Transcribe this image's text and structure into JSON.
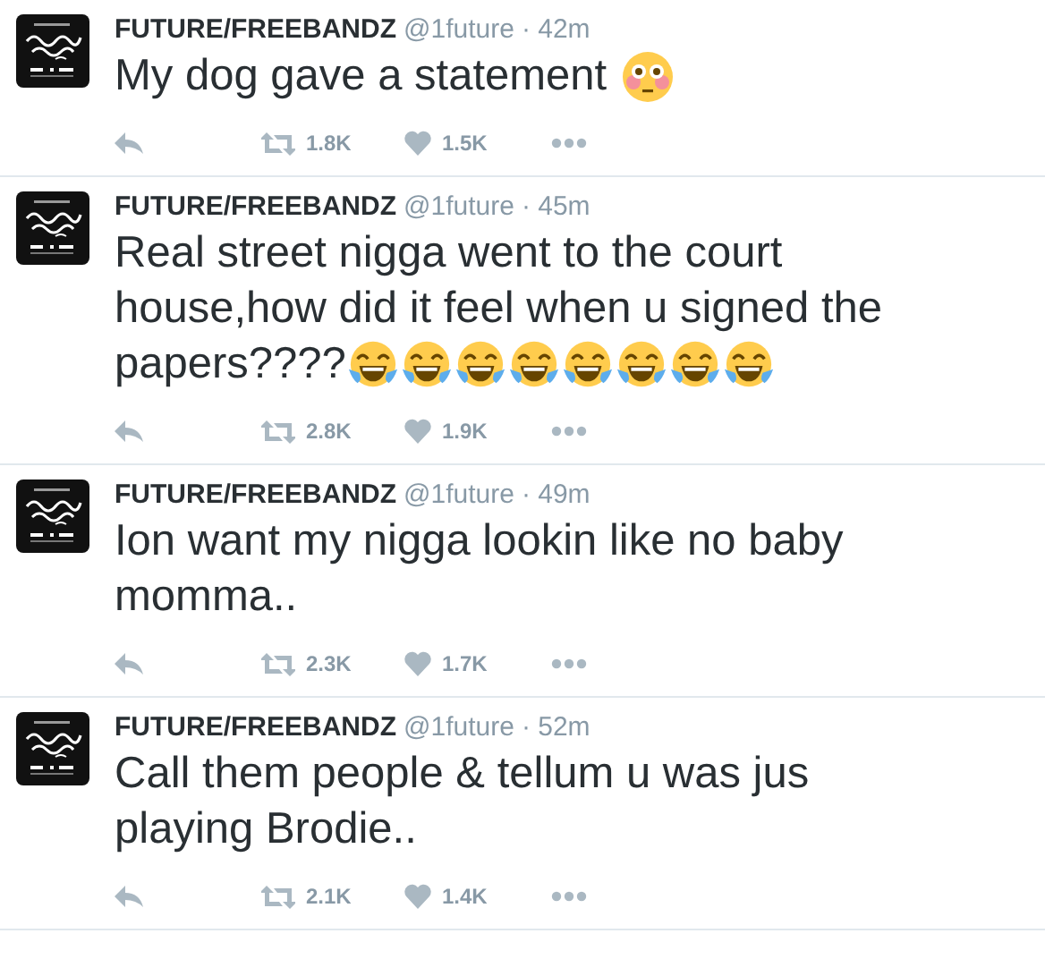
{
  "tweets": [
    {
      "name": "FUTURE/FREEBANDZ",
      "handle": "@1future",
      "time": "· 42m",
      "lines": [
        "My dog gave a statement"
      ],
      "emojis": [
        {
          "kind": "flushed"
        }
      ],
      "retweets": "1.8K",
      "likes": "1.5K"
    },
    {
      "name": "FUTURE/FREEBANDZ",
      "handle": "@1future",
      "time": "· 45m",
      "lines": [
        "Real street nigga went to the court",
        "house,how did it feel when u signed the",
        "papers????"
      ],
      "emojis": [
        {
          "kind": "tears-of-joy"
        },
        {
          "kind": "tears-of-joy"
        },
        {
          "kind": "tears-of-joy"
        },
        {
          "kind": "tears-of-joy"
        },
        {
          "kind": "tears-of-joy"
        },
        {
          "kind": "tears-of-joy"
        },
        {
          "kind": "tears-of-joy"
        },
        {
          "kind": "tears-of-joy"
        }
      ],
      "retweets": "2.8K",
      "likes": "1.9K"
    },
    {
      "name": "FUTURE/FREEBANDZ",
      "handle": "@1future",
      "time": "· 49m",
      "lines": [
        "Ion want my nigga lookin like no baby",
        "momma.."
      ],
      "retweets": "2.3K",
      "likes": "1.7K"
    },
    {
      "name": "FUTURE/FREEBANDZ",
      "handle": "@1future",
      "time": "· 52m",
      "lines": [
        "Call them people & tellum u was jus",
        "playing Brodie.."
      ],
      "retweets": "2.1K",
      "likes": "1.4K"
    }
  ]
}
